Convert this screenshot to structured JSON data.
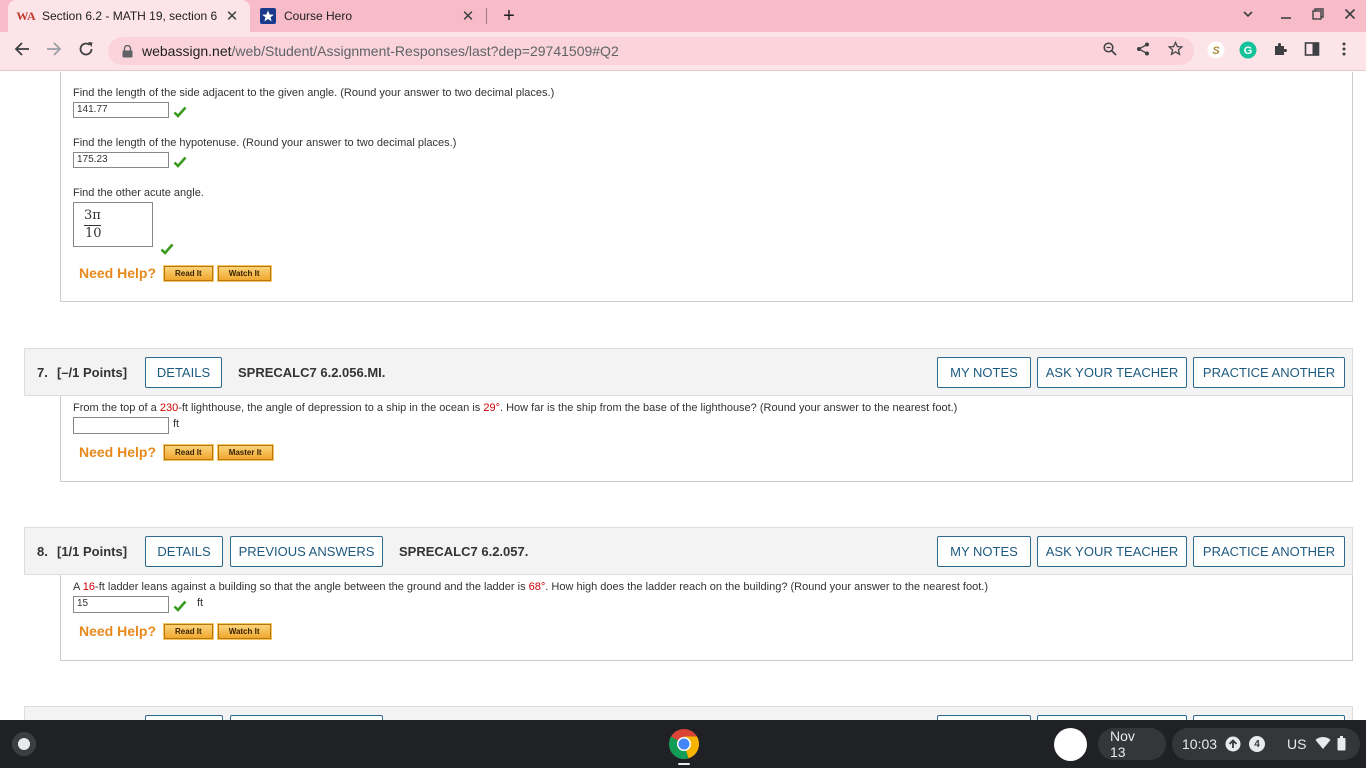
{
  "browser": {
    "tabs": [
      {
        "title": "Section 6.2 - MATH 19, section 6",
        "favicon": "WA",
        "active": true
      },
      {
        "title": "Course Hero",
        "favicon": "star",
        "active": false
      }
    ],
    "url_host": "webassign.net",
    "url_path": "/web/Student/Assignment-Responses/last?dep=29741509#Q2"
  },
  "q6": {
    "prompt_adjacent": "Find the length of the side adjacent to the given angle. (Round your answer to two decimal places.)",
    "answer_adjacent": "141.77",
    "prompt_hypotenuse": "Find the length of the hypotenuse. (Round your answer to two decimal places.)",
    "answer_hypotenuse": "175.23",
    "prompt_angle": "Find the other acute angle.",
    "angle_numerator": "3π",
    "angle_denominator": "10",
    "help_label": "Need Help?",
    "btn_read": "Read It",
    "btn_watch": "Watch It"
  },
  "q7": {
    "number": "7.",
    "points": "[–/1 Points]",
    "details": "DETAILS",
    "code": "SPRECALC7 6.2.056.MI.",
    "my_notes": "MY NOTES",
    "ask_teacher": "ASK YOUR TEACHER",
    "practice": "PRACTICE ANOTHER",
    "p1": "From the top of a ",
    "v1": "230",
    "p2": "-ft lighthouse, the angle of depression to a ship in the ocean is ",
    "v2": "29°",
    "p3": ". How far is the ship from the base of the lighthouse? (Round your answer to the nearest foot.)",
    "answer": "",
    "unit": "ft",
    "help_label": "Need Help?",
    "btn_read": "Read It",
    "btn_master": "Master It"
  },
  "q8": {
    "number": "8.",
    "points": "[1/1 Points]",
    "details": "DETAILS",
    "previous": "PREVIOUS ANSWERS",
    "code": "SPRECALC7 6.2.057.",
    "my_notes": "MY NOTES",
    "ask_teacher": "ASK YOUR TEACHER",
    "practice": "PRACTICE ANOTHER",
    "p1": "A ",
    "v1": "16",
    "p2": "-ft ladder leans against a building so that the angle between the ground and the ladder is ",
    "v2": "68°",
    "p3": ". How high does the ladder reach on the building? (Round your answer to the nearest foot.)",
    "answer": "15",
    "unit": "ft",
    "help_label": "Need Help?",
    "btn_read": "Read It",
    "btn_watch": "Watch It"
  },
  "shelf": {
    "date": "Nov 13",
    "time": "10:03",
    "notif_count": "4",
    "ime": "US"
  },
  "colors": {
    "tab_strip": "#f8bcc8",
    "toolbar": "#fde4e9",
    "button_blue": "#1d5a80",
    "help_orange": "#e8891c",
    "value_red": "#cc0000",
    "check_green": "#3a9a1f"
  }
}
